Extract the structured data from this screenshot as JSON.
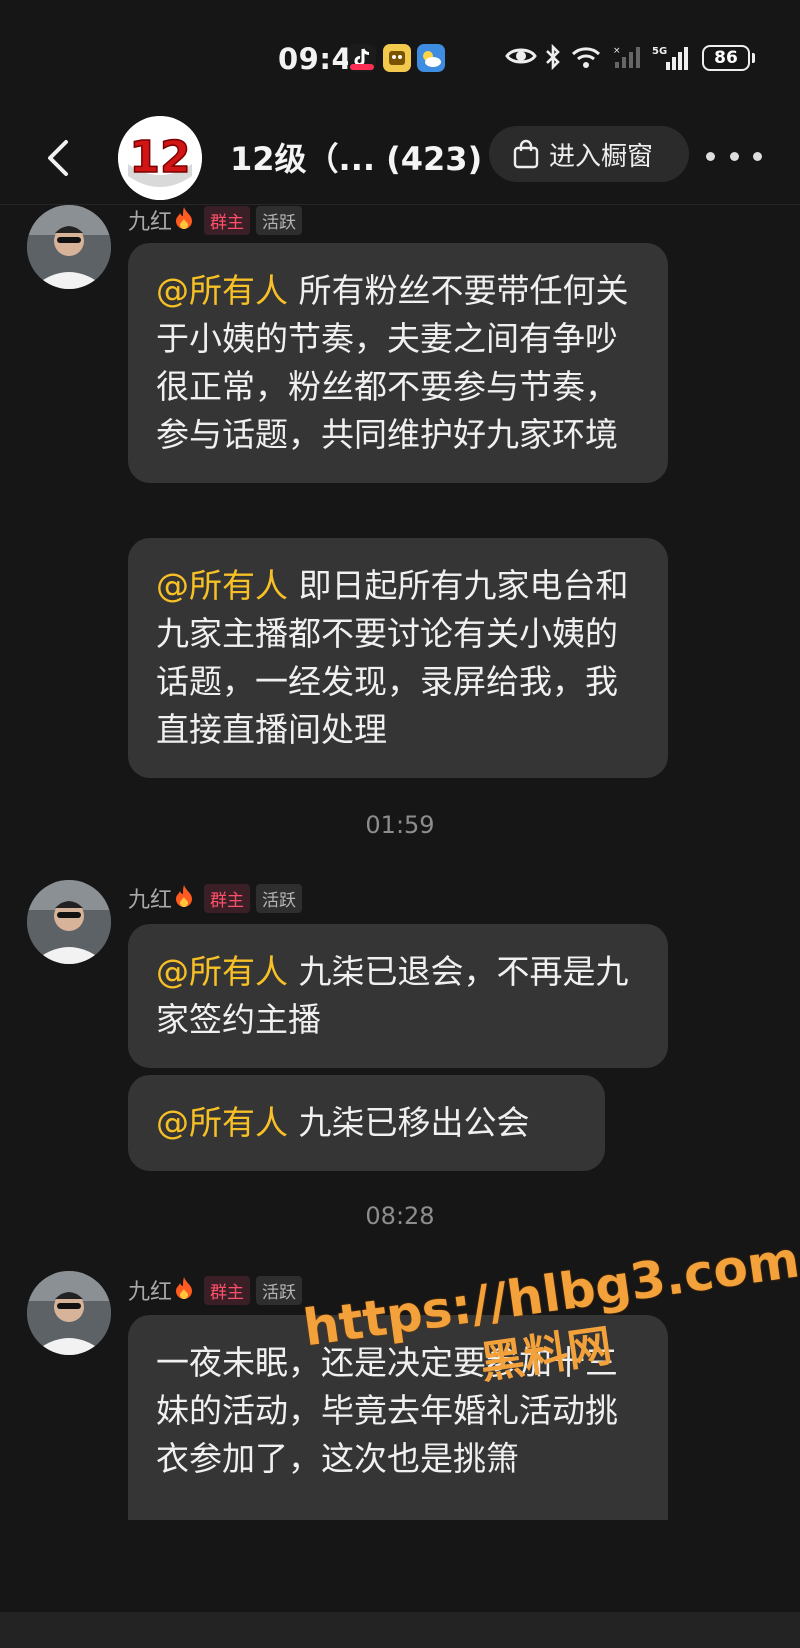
{
  "status_bar": {
    "time": "09:42",
    "battery": "86",
    "net_label": "5G"
  },
  "header": {
    "group_title": "12级（... (423)",
    "group_avatar_text": "12",
    "shop_button": "进入橱窗"
  },
  "chat": {
    "messages": [
      {
        "sender": "九红",
        "role_badge": "群主",
        "activity_badge": "活跃",
        "bubbles": [
          {
            "mention": "@所有人",
            "text": " 所有粉丝不要带任何关于小姨的节奏，夫妻之间有争吵很正常，粉丝都不要参与节奏，参与话题，共同维护好九家环境"
          },
          {
            "mention": "@所有人",
            "text": " 即日起所有九家电台和九家主播都不要讨论有关小姨的话题，一经发现，录屏给我，我直接直播间处理"
          }
        ]
      },
      {
        "time_separator": "01:59",
        "sender": "九红",
        "role_badge": "群主",
        "activity_badge": "活跃",
        "bubbles": [
          {
            "mention": "@所有人",
            "text": " 九柒已退会，不再是九家签约主播"
          },
          {
            "mention": "@所有人",
            "text": " 九柒已移出公会"
          }
        ]
      },
      {
        "time_separator": "08:28",
        "sender": "九红",
        "role_badge": "群主",
        "activity_badge": "活跃",
        "bubbles": [
          {
            "mention": "",
            "text": "一夜未眠，还是决定要参加十三妹的活动，毕竟去年婚礼活动挑衣参加了，这次也是挑箫"
          }
        ]
      }
    ]
  },
  "watermark": {
    "url": "https://hlbg3.com",
    "sub": "黑料网"
  },
  "colors": {
    "background": "#161616",
    "bubble": "#353535",
    "mention": "#f6c026",
    "owner_badge": "#ff4f6c",
    "watermark": "#f3a13a"
  },
  "icons": [
    "back-chevron-icon",
    "bag-icon",
    "more-dots-icon",
    "eye-icon",
    "bluetooth-icon",
    "wifi-icon",
    "signal-icon",
    "battery-icon",
    "fire-icon"
  ]
}
